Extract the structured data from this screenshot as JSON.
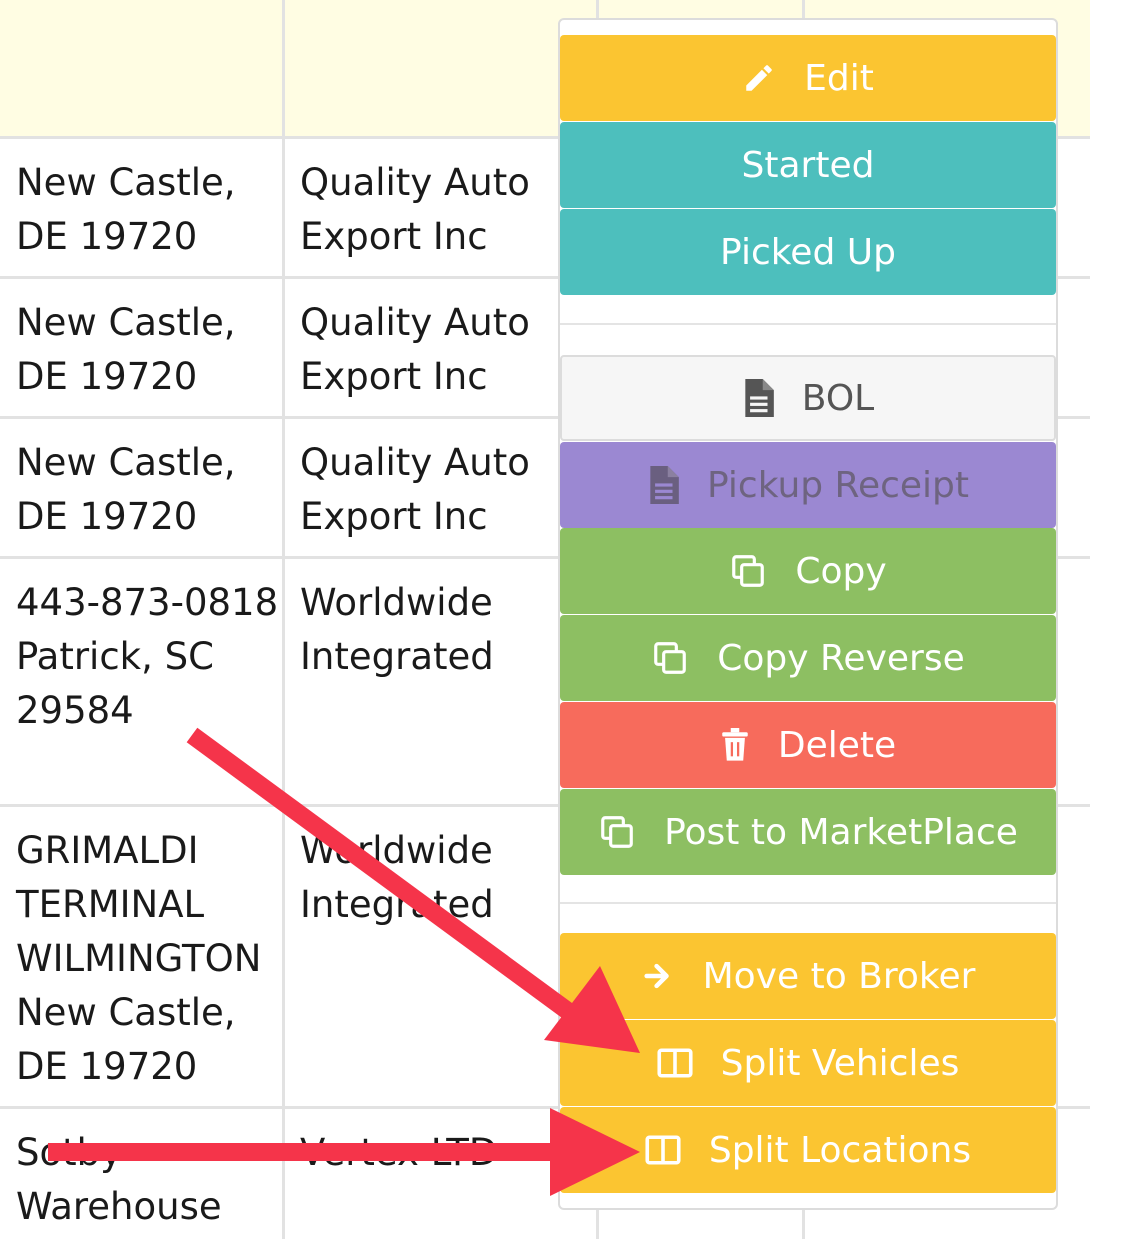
{
  "table": {
    "rows": [
      {
        "location": [
          "New Castle,",
          "DE 19720"
        ],
        "company": [
          "Quality Auto",
          "Export Inc"
        ]
      },
      {
        "location": [
          "New Castle,",
          "DE 19720"
        ],
        "company": [
          "Quality Auto",
          "Export Inc"
        ]
      },
      {
        "location": [
          "New Castle,",
          "DE 19720"
        ],
        "company": [
          "Quality Auto",
          "Export Inc"
        ]
      },
      {
        "location": [
          "443-873-0818",
          "Patrick, SC",
          "29584"
        ],
        "company": [
          "Worldwide",
          "Integrated"
        ]
      },
      {
        "location": [
          "GRIMALDI",
          "TERMINAL",
          "WILMINGTON",
          "New Castle,",
          "DE 19720"
        ],
        "company": [
          "Worldwide",
          "Integrated"
        ]
      },
      {
        "location": [
          "Sotby",
          "Warehouse"
        ],
        "company": [
          "Vertex LTD"
        ]
      }
    ]
  },
  "menu": {
    "edit": "Edit",
    "started": "Started",
    "picked_up": "Picked Up",
    "bol": "BOL",
    "pickup_receipt": "Pickup Receipt",
    "copy": "Copy",
    "copy_reverse": "Copy Reverse",
    "delete": "Delete",
    "post_marketplace": "Post to MarketPlace",
    "move_to_broker": "Move to Broker",
    "split_vehicles": "Split Vehicles",
    "split_locations": "Split Locations"
  },
  "colors": {
    "yellow": "#fbc531",
    "teal": "#4dbfbd",
    "purple": "#9b88d2",
    "green": "#8dbf62",
    "red": "#f76b5c",
    "arrow": "#f5344a",
    "header_bg": "#fffde3"
  },
  "icons": {
    "edit": "pencil-icon",
    "bol": "document-icon",
    "pickup_receipt": "document-icon",
    "copy": "copy-icon",
    "copy_reverse": "copy-icon",
    "delete": "trash-icon",
    "post_marketplace": "copy-icon",
    "move_to_broker": "arrow-right-icon",
    "split_vehicles": "columns-icon",
    "split_locations": "columns-icon"
  }
}
